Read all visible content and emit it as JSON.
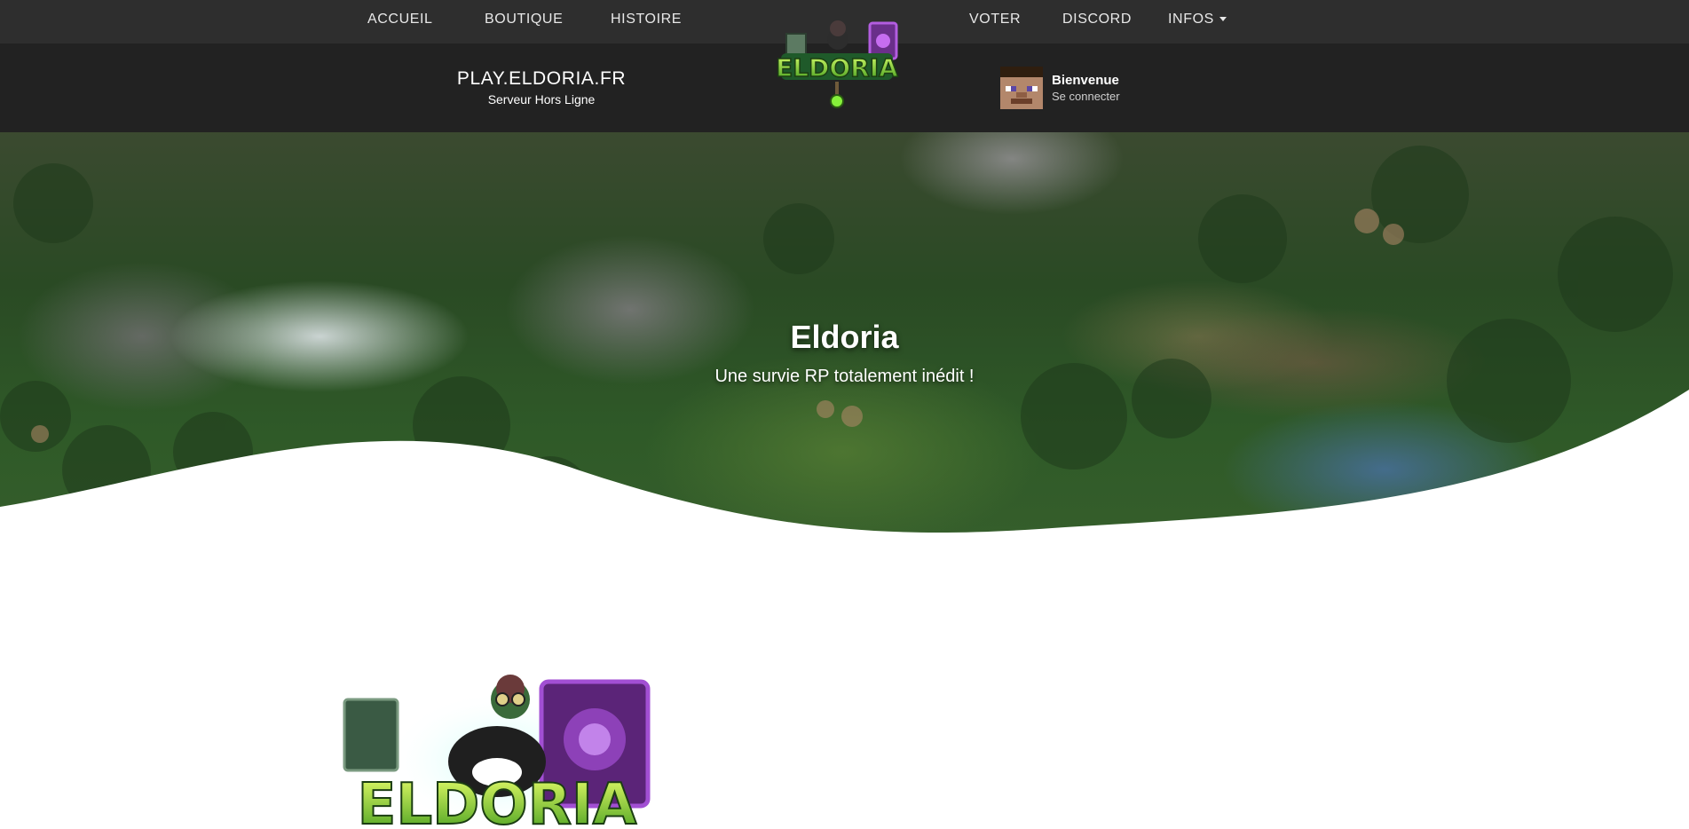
{
  "nav": {
    "items": [
      {
        "label": "ACCUEIL"
      },
      {
        "label": "BOUTIQUE"
      },
      {
        "label": "HISTOIRE"
      },
      {
        "label": "VOTER"
      },
      {
        "label": "DISCORD"
      },
      {
        "label": "INFOS"
      }
    ]
  },
  "server": {
    "address": "PLAY.ELDORIA.FR",
    "status": "Serveur Hors Ligne"
  },
  "user": {
    "welcome": "Bienvenue",
    "login": "Se connecter"
  },
  "logo": {
    "text": "ELDORIA"
  },
  "hero": {
    "title": "Eldoria",
    "subtitle": "Une survie RP totalement inédit !"
  },
  "colors": {
    "topnav_bg": "#2e2e2e",
    "infobar_bg": "#222222",
    "logo_green": "#7ccf2b",
    "logo_purple": "#a24fd3"
  }
}
